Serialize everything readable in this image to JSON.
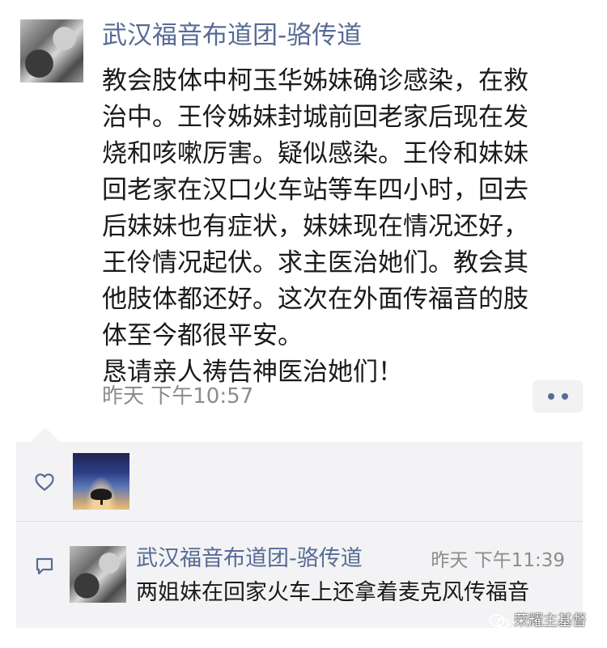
{
  "post": {
    "author": "武汉福音布道团-骆传道",
    "body_lines": [
      "教会肢体中柯玉华姊妹确诊感染，在救",
      "治中。王伶姊妹封城前回老家后现在发",
      "烧和咳嗽厉害。疑似感染。王伶和妹妹",
      "回老家在汉口火车站等车四小时，回去",
      "后妹妹也有症状，妹妹现在情况还好，",
      "王伶情况起伏。求主医治她们。教会其",
      "他肢体都还好。这次在外面传福音的肢",
      "体至今都很平安。",
      "恳请亲人祷告神医治她们！"
    ],
    "timestamp": "昨天 下午10:57"
  },
  "comment": {
    "author": "武汉福音布道团-骆传道",
    "time": "昨天 下午11:39",
    "text": "两姐妹在回家火车上还拿着麦克风传福音"
  },
  "watermark": {
    "text": "荣耀主基督"
  },
  "icons": {
    "like": "heart-icon",
    "comment": "comment-icon",
    "more": "more-dots-icon",
    "watermark": "wechat-icon"
  },
  "colors": {
    "name_link": "#576b95",
    "body_text": "#1a1a1a",
    "meta_text": "#8c8c8c",
    "panel_bg": "#f3f3f5",
    "divider": "#e0e0e3"
  }
}
